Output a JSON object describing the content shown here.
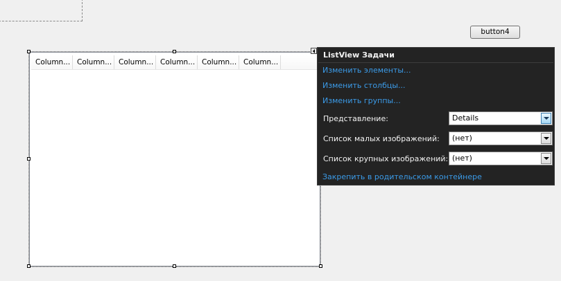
{
  "designer": {
    "button4_label": "button4"
  },
  "listview": {
    "columns": [
      "Column...",
      "Column...",
      "Column...",
      "Column...",
      "Column...",
      "Column..."
    ]
  },
  "tasks_panel": {
    "title": "ListView Задачи",
    "links": {
      "edit_items": "Изменить элементы...",
      "edit_columns": "Изменить столбцы...",
      "edit_groups": "Изменить группы...",
      "dock": "Закрепить в родительском контейнере"
    },
    "view": {
      "label": "Представление:",
      "value": "Details"
    },
    "small_images": {
      "label": "Список малых изображений:",
      "value": "(нет)"
    },
    "large_images": {
      "label": "Список крупных изображений:",
      "value": "(нет)"
    }
  },
  "colors": {
    "panel_bg": "#232323",
    "link": "#3b9be8",
    "designer_bg": "#f0f0f0"
  }
}
